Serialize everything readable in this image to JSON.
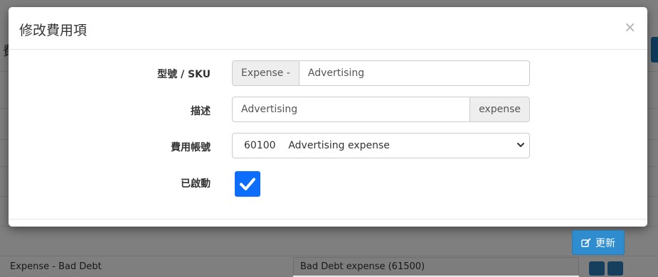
{
  "background": {
    "heading_char": "費",
    "row_left_text": "Expense - Bad Debt",
    "row_right_text": "Bad Debt expense (61500)"
  },
  "modal": {
    "title": "修改費用項",
    "close_label": "×"
  },
  "form": {
    "sku": {
      "label": "型號 / SKU",
      "prefix": "Expense -",
      "value": "Advertising"
    },
    "description": {
      "label": "描述",
      "value": "Advertising",
      "suffix": "expense"
    },
    "account": {
      "label": "費用帳號",
      "selected": "60100    Advertising expense"
    },
    "enabled": {
      "label": "已啟動",
      "checked": true
    }
  },
  "footer": {
    "update_label": "更新"
  },
  "colors": {
    "primary": "#2e8ccf",
    "checkbox": "#0d6efd"
  }
}
